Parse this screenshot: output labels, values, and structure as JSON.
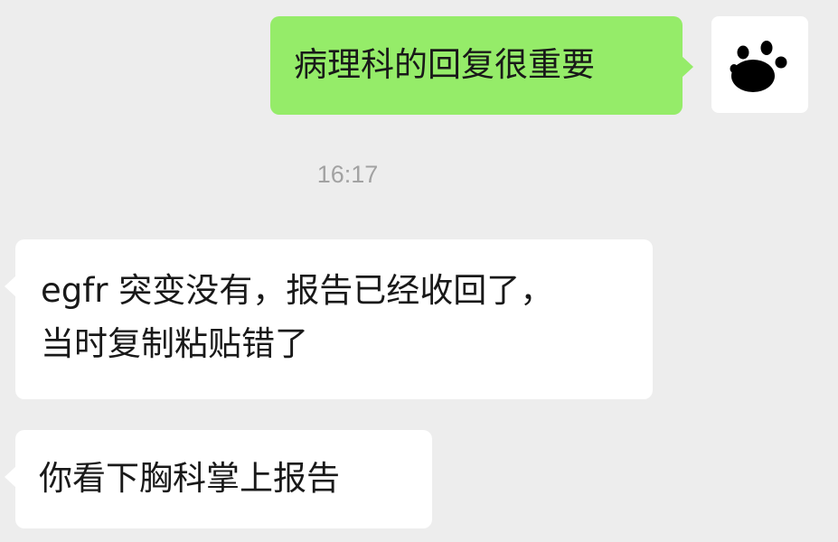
{
  "chat": {
    "messages": [
      {
        "direction": "outgoing",
        "text": "病理科的回复很重要",
        "bubble_color": "#95ec69"
      },
      {
        "direction": "incoming",
        "lines": [
          "egfr 突变没有，报告已经收回了，",
          "当时复制粘贴错了"
        ],
        "bubble_color": "#ffffff"
      },
      {
        "direction": "incoming",
        "text": "你看下胸科掌上报告",
        "bubble_color": "#ffffff"
      }
    ],
    "timestamp": "16:17",
    "avatar": {
      "icon": "paw-print-icon",
      "background": "#ffffff",
      "color": "#000000"
    },
    "background_color": "#ededed"
  }
}
